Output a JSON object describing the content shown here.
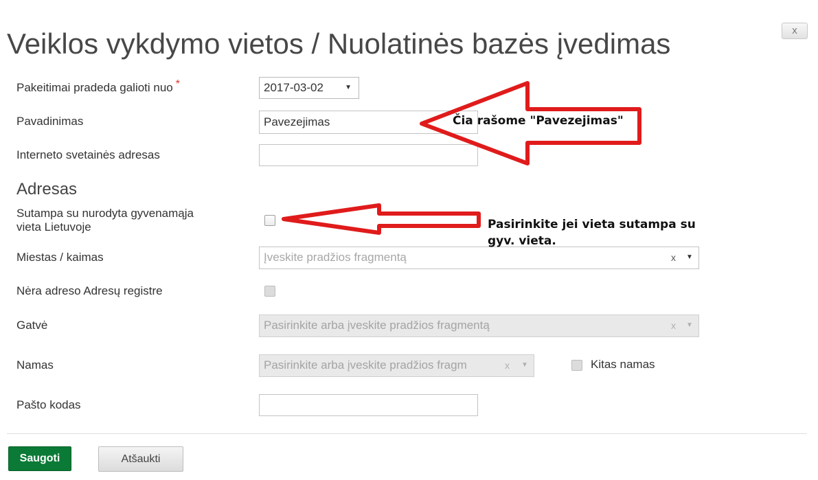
{
  "dialog": {
    "close_label": "x",
    "title": "Veiklos vykdymo vietos / Nuolatinės bazės įvedimas"
  },
  "form": {
    "effective_date": {
      "label": "Pakeitimai pradeda galioti nuo",
      "required_mark": "*",
      "value": "2017-03-02"
    },
    "name": {
      "label": "Pavadinimas",
      "value": "Pavezejimas"
    },
    "website": {
      "label": "Interneto svetainės adresas",
      "value": ""
    },
    "address_section_title": "Adresas",
    "same_as_residence": {
      "label_line1": "Sutampa su nurodyta gyvenamąja",
      "label_line2": "vieta Lietuvoje",
      "checked": false
    },
    "city": {
      "label": "Miestas / kaimas",
      "placeholder": "Įveskite pradžios fragmentą",
      "clear": "x"
    },
    "no_registry_address": {
      "label": "Nėra adreso Adresų registre",
      "checked": false
    },
    "street": {
      "label": "Gatvė",
      "placeholder": "Pasirinkite arba įveskite pradžios fragmentą",
      "clear": "x"
    },
    "house": {
      "label": "Namas",
      "placeholder": "Pasirinkite arba įveskite pradžios fragm",
      "clear": "x",
      "other_house_label": "Kitas namas"
    },
    "postal_code": {
      "label": "Pašto kodas",
      "value": ""
    }
  },
  "annotations": {
    "name_hint": "Čia rašome \"Pavezejimas\"",
    "checkbox_hint_line1": "Pasirinkite jei vieta sutampa su",
    "checkbox_hint_line2": "gyv. vieta.",
    "arrow_color": "#e01b1b"
  },
  "buttons": {
    "save": "Saugoti",
    "cancel": "Atšaukti"
  },
  "colors": {
    "save_button": "#0a7a36",
    "required": "#e0342a"
  }
}
